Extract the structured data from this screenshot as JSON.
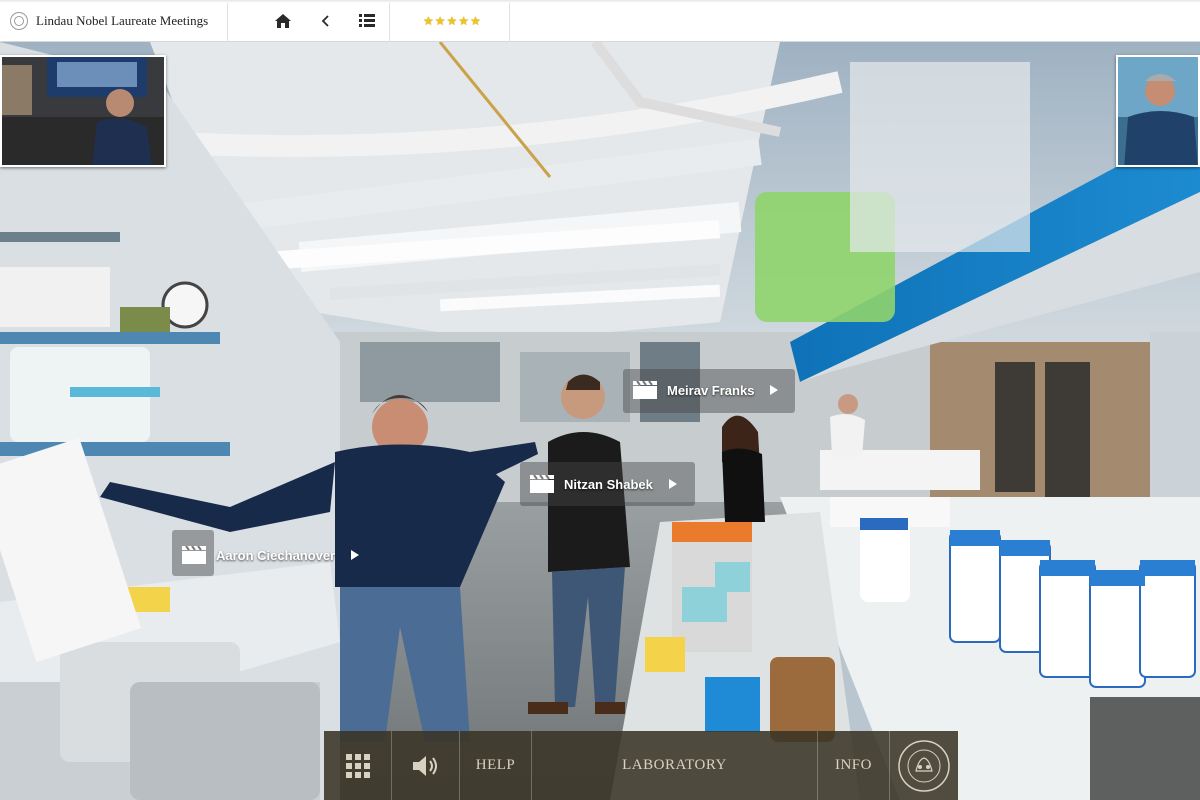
{
  "header": {
    "title": "Lindau Nobel Laureate Meetings",
    "rating_stars": 5,
    "icons": [
      "home-icon",
      "back-icon",
      "list-icon"
    ]
  },
  "hotspots": [
    {
      "label": "Aaron Ciechanover",
      "icon": "film-clapper-icon"
    },
    {
      "label": "Nitzan Shabek",
      "icon": "film-clapper-icon"
    },
    {
      "label": "Meirav Franks",
      "icon": "film-clapper-icon"
    }
  ],
  "controls": {
    "grid_icon": "grid-icon",
    "sound_icon": "speaker-icon",
    "help": "HELP",
    "location": "LABORATORY",
    "info": "INFO",
    "seal_icon": "lindau-seal-icon"
  },
  "colors": {
    "star": "#f0c419",
    "control_bar": "#3a3426",
    "control_text": "#d8d2c0"
  }
}
